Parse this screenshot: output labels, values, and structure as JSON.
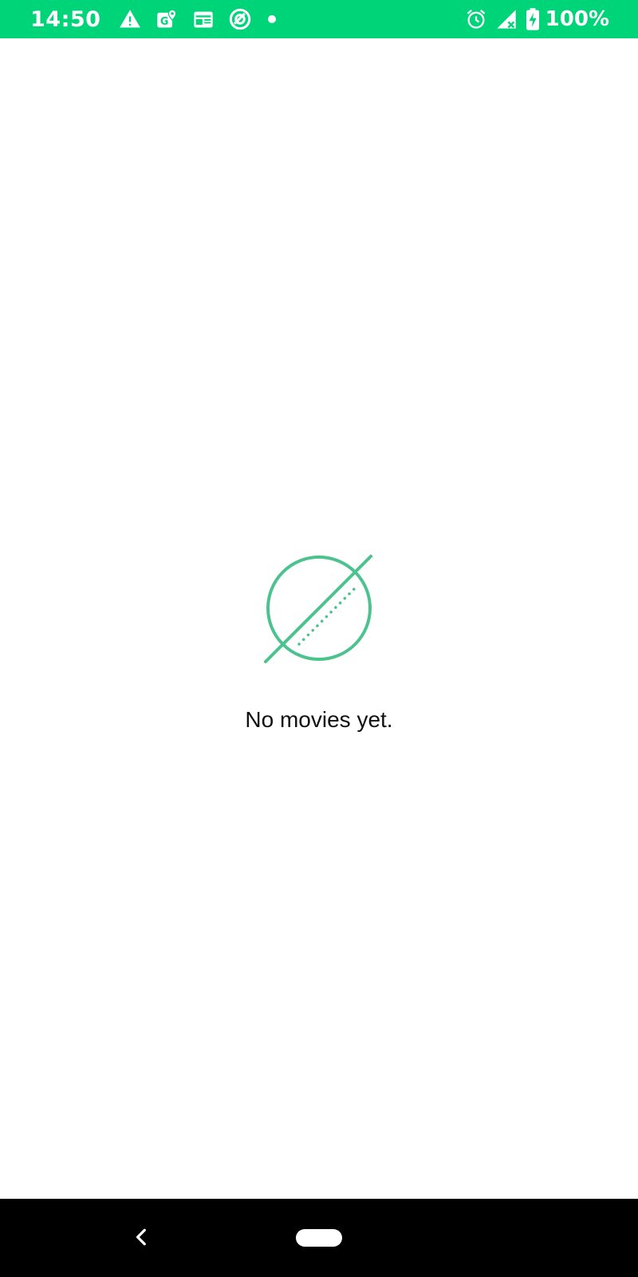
{
  "status_bar": {
    "time": "14:50",
    "battery": "100%",
    "background": "#00d478",
    "left_icons": [
      "warning-icon",
      "maps-icon",
      "news-icon",
      "app-icon",
      "notification-dot-icon"
    ],
    "right_icons": [
      "alarm-icon",
      "signal-icon",
      "battery-charging-icon"
    ]
  },
  "empty_state": {
    "icon": "empty-set-icon",
    "icon_color": "#4cc28f",
    "message": "No movies yet."
  },
  "nav_bar": {
    "background": "#000000",
    "buttons": [
      "back-button",
      "home-button"
    ]
  }
}
